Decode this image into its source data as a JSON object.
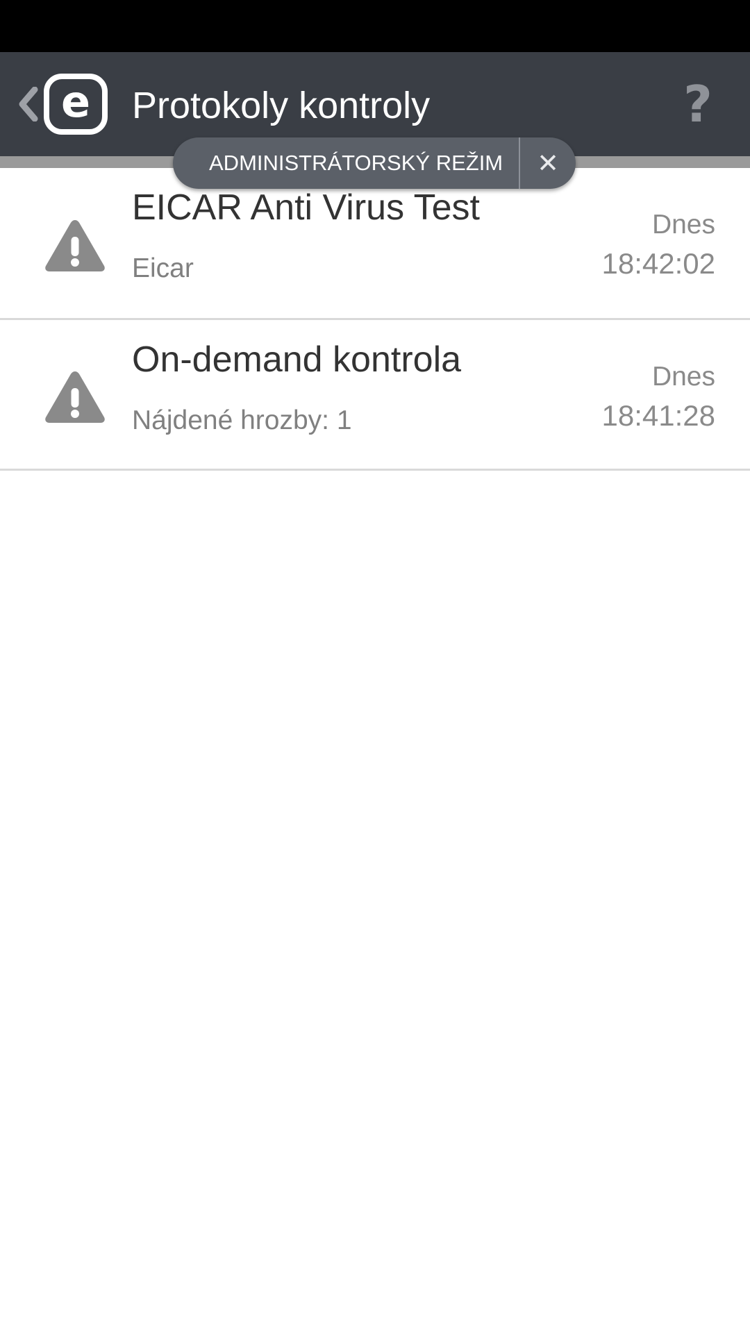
{
  "app_bar": {
    "title": "Protokoly kontroly",
    "back_icon": "chevron-left-icon",
    "logo_letter": "e",
    "help_label": "?"
  },
  "admin_mode": {
    "label": "ADMINISTRÁTORSKÝ REŽIM",
    "close_label": "✕"
  },
  "logs": [
    {
      "title": "EICAR Anti Virus Test",
      "subtitle": "Eicar",
      "day": "Dnes",
      "time": "18:42:02",
      "icon": "warning-icon"
    },
    {
      "title": "On-demand kontrola",
      "subtitle": "Nájdené hrozby: 1",
      "day": "Dnes",
      "time": "18:41:28",
      "icon": "warning-icon"
    }
  ],
  "colors": {
    "app_bar": "#3a3e45",
    "stripe": "#9a9a9a",
    "pill": "#5b6068",
    "icon_gray": "#8a8a8a"
  }
}
